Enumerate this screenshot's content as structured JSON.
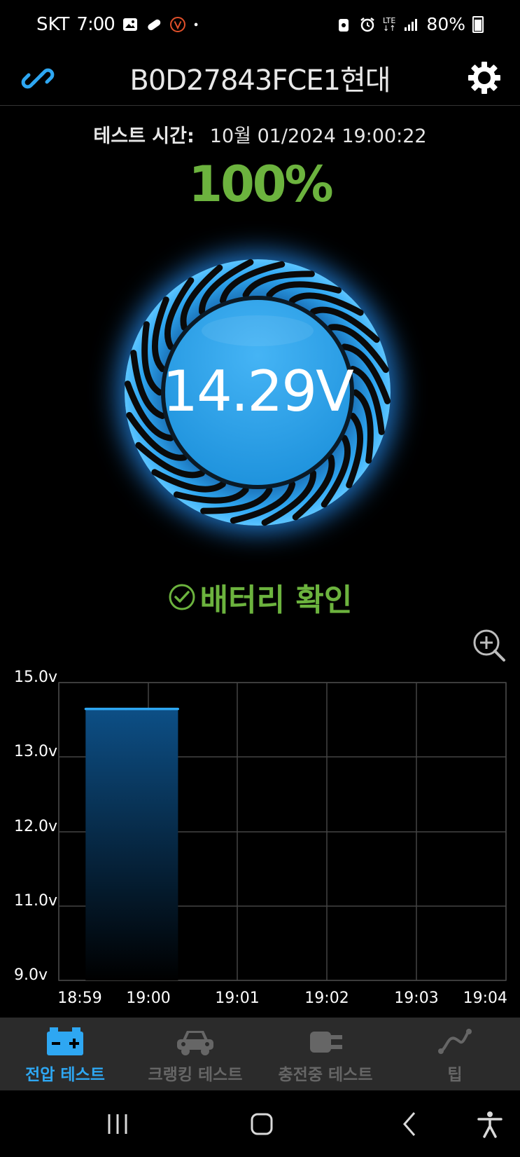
{
  "status_bar": {
    "carrier": "SKT",
    "time": "7:00",
    "network": "LTE",
    "battery": "80%",
    "left_icons": [
      "gallery-icon",
      "pill-icon",
      "v-badge-icon",
      "dot-icon"
    ],
    "right_icons": [
      "lock-saver-icon",
      "alarm-icon",
      "lte-icon",
      "signal-icon",
      "battery-icon"
    ]
  },
  "header": {
    "title": "B0D27843FCE1현대",
    "left_icon": "link-icon",
    "right_icon": "gear-icon"
  },
  "test": {
    "time_label": "테스트 시간:",
    "time_value": "10월 01/2024 19:00:22",
    "percent": "100%",
    "voltage": "14.29V",
    "status": "배터리 확인",
    "status_icon": "check-circle-icon"
  },
  "zoom_icon": "zoom-in-icon",
  "chart_data": {
    "type": "area",
    "x_ticks": [
      "18:59",
      "19:00",
      "19:01",
      "19:02",
      "19:03",
      "19:04"
    ],
    "y_ticks": [
      "15.0v",
      "13.0v",
      "12.0v",
      "11.0v",
      "9.0v"
    ],
    "series": [
      {
        "x": [
          "18:59:18",
          "18:59:30",
          "18:59:45",
          "19:00:00",
          "19:00:15",
          "19:00:20"
        ],
        "values": [
          14.29,
          14.29,
          14.29,
          14.29,
          14.29,
          14.29
        ]
      }
    ],
    "grid": true,
    "colors": {
      "line": "#2ea7f2",
      "fill_top": "#0d4f86",
      "fill_bottom": "#000000",
      "grid": "#444444"
    }
  },
  "bottom_nav": [
    {
      "label": "전압 테스트",
      "icon": "battery-icon",
      "active": true
    },
    {
      "label": "크랭킹 테스트",
      "icon": "car-icon",
      "active": false
    },
    {
      "label": "충전중 테스트",
      "icon": "plug-icon",
      "active": false
    },
    {
      "label": "팁",
      "icon": "trend-icon",
      "active": false
    }
  ],
  "system_nav": [
    "recent-apps-icon",
    "home-icon",
    "back-icon",
    "accessibility-icon"
  ],
  "colors": {
    "accent_blue": "#2ea7f2",
    "status_green": "#6cb33e",
    "nav_bg": "#2b2b2b",
    "inactive_gray": "#666666"
  }
}
